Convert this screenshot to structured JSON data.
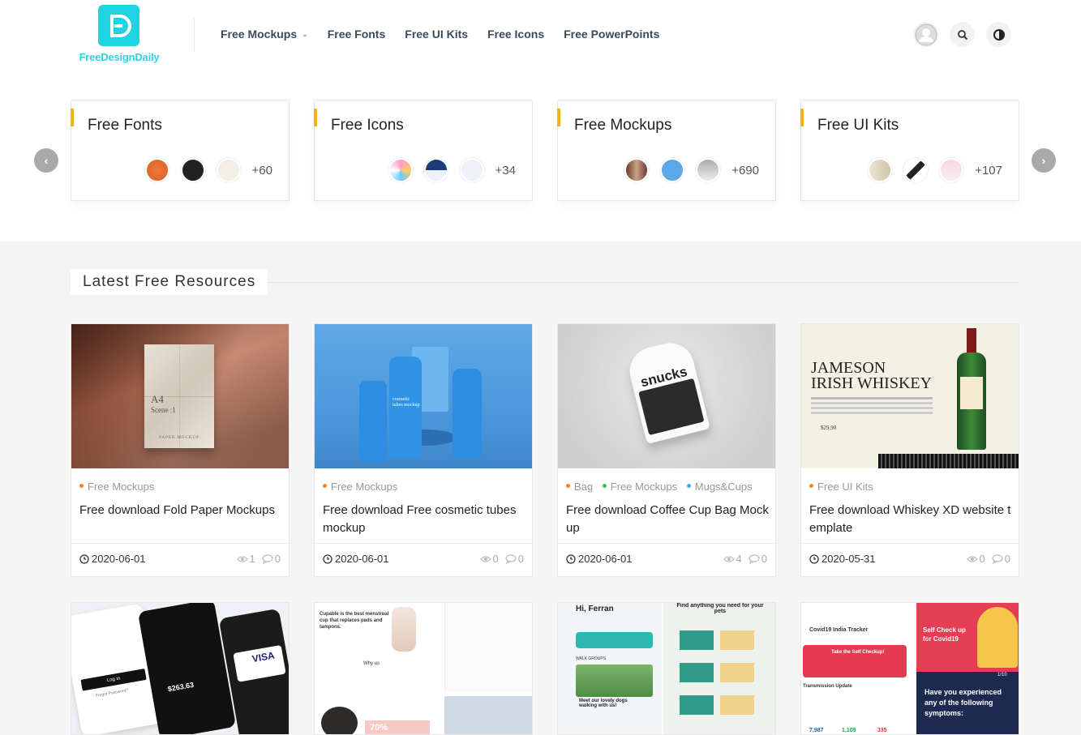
{
  "site": {
    "logo_text": "FreeDesignDaily",
    "brand_color": "#1fd3e3"
  },
  "nav": {
    "items": [
      {
        "label": "Free Mockups",
        "has_dropdown": true
      },
      {
        "label": "Free Fonts"
      },
      {
        "label": "Free UI Kits"
      },
      {
        "label": "Free Icons"
      },
      {
        "label": "Free PowerPoints"
      }
    ],
    "icons": [
      "user-icon",
      "search-icon",
      "theme-toggle-icon"
    ]
  },
  "categories": [
    {
      "title": "Free Fonts",
      "count": "+60"
    },
    {
      "title": "Free Icons",
      "count": "+34"
    },
    {
      "title": "Free Mockups",
      "count": "+690"
    },
    {
      "title": "Free UI Kits",
      "count": "+107"
    }
  ],
  "section": {
    "title": "Latest Free Resources"
  },
  "resources": [
    {
      "cats": [
        {
          "name": "Free Mockups",
          "color": "#f5832a"
        }
      ],
      "title": "Free download Fold Paper Mockups",
      "date": "2020-06-01",
      "views": "1",
      "comments": "0",
      "img_text": {
        "line1": "A4",
        "line2": "Scene :1",
        "line3": "PAPER MOCKUP"
      }
    },
    {
      "cats": [
        {
          "name": "Free Mockups",
          "color": "#f5832a"
        }
      ],
      "title": "Free download Free cosmetic tubes mockup",
      "date": "2020-06-01",
      "views": "0",
      "comments": "0",
      "img_text": {
        "line1": "cosmetic tubes mockup"
      }
    },
    {
      "cats": [
        {
          "name": "Bag",
          "color": "#f5832a"
        },
        {
          "name": "Free Mockups",
          "color": "#44bb55"
        },
        {
          "name": "Mugs&Cups",
          "color": "#3fa9f5"
        }
      ],
      "title": "Free download Coffee Cup Bag Mockup",
      "date": "2020-06-01",
      "views": "4",
      "comments": "0",
      "img_text": {
        "line1": "snucks"
      }
    },
    {
      "cats": [
        {
          "name": "Free UI Kits",
          "color": "#f5832a"
        }
      ],
      "title": "Free download Whiskey XD website template",
      "date": "2020-05-31",
      "views": "0",
      "comments": "0",
      "img_text": {
        "line1": "JAMESON",
        "line2": "IRISH WHISKEY",
        "line3": "$29.90"
      }
    }
  ],
  "previews": {
    "p1": {
      "l1": "VISA",
      "l2": "$263.63",
      "l3": "Log in",
      "l4": "Forgot Password?"
    },
    "p2": {
      "l1": "Cupable is the best menstrual cup that replaces pads and tampons.",
      "l2": "Why us",
      "l3": "70%"
    },
    "p3": {
      "l1": "Hi, Ferran",
      "l2": "Find anything you need for your pets",
      "l3": "WALK GROUPS",
      "l4": "Meet our lovely dogs walking with us!"
    },
    "p4": {
      "l1": "Covid19 India Tracker",
      "l2": "Take the Self Checkup!",
      "l3": "Transmission Update",
      "l4": "Self Check up for Covid19",
      "l5": "Have you experienced any of the following symptoms:",
      "n1": "7,987",
      "n2": "1,109",
      "n3": "335",
      "pager": "1/10"
    }
  }
}
